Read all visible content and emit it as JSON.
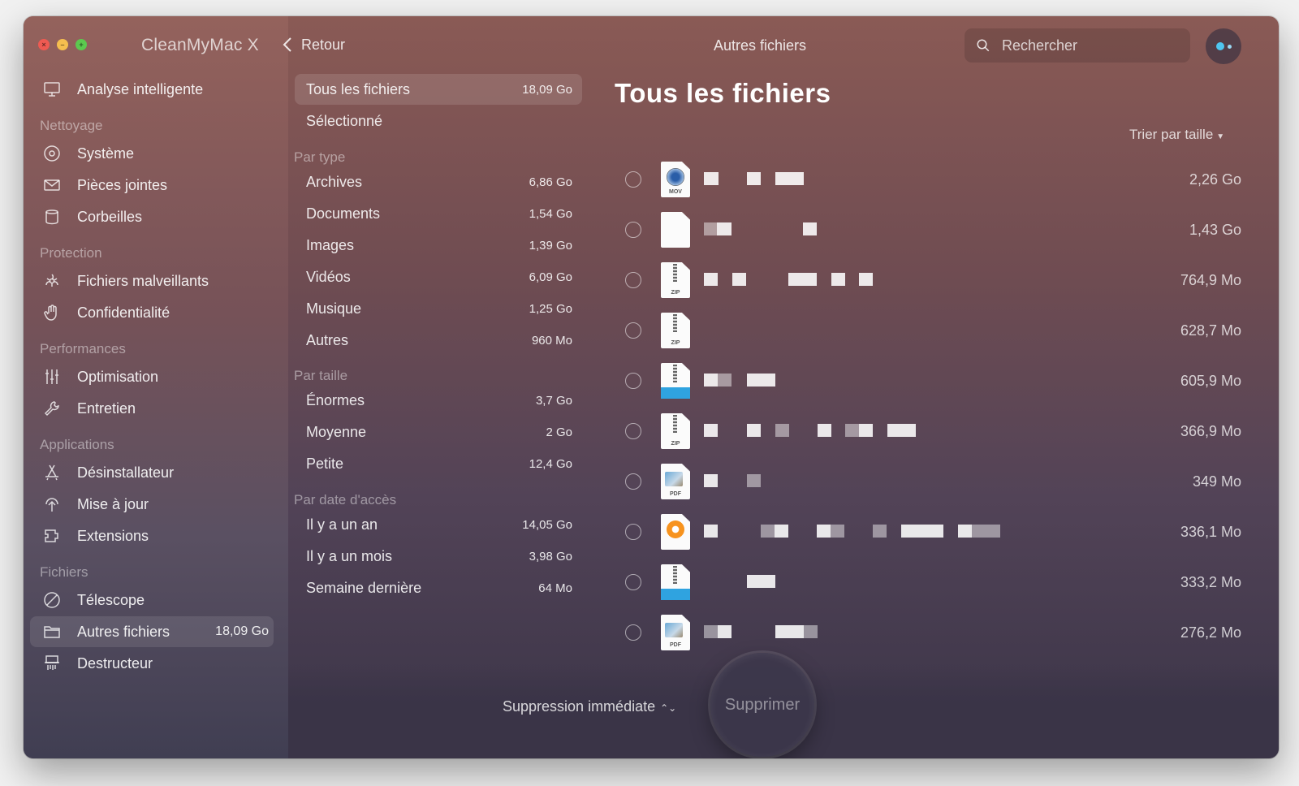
{
  "window": {
    "app_name": "CleanMyMac X",
    "back_label": "Retour",
    "toolbar_title": "Autres fichiers",
    "search_placeholder": "Rechercher"
  },
  "sidebar": {
    "top_item": {
      "label": "Analyse intelligente",
      "icon": "monitor-icon"
    },
    "sections": [
      {
        "title": "Nettoyage",
        "items": [
          {
            "label": "Système",
            "icon": "disk-icon"
          },
          {
            "label": "Pièces jointes",
            "icon": "mail-icon"
          },
          {
            "label": "Corbeilles",
            "icon": "trash-icon"
          }
        ]
      },
      {
        "title": "Protection",
        "items": [
          {
            "label": "Fichiers malveillants",
            "icon": "biohazard-icon"
          },
          {
            "label": "Confidentialité",
            "icon": "hand-icon"
          }
        ]
      },
      {
        "title": "Performances",
        "items": [
          {
            "label": "Optimisation",
            "icon": "sliders-icon"
          },
          {
            "label": "Entretien",
            "icon": "wrench-icon"
          }
        ]
      },
      {
        "title": "Applications",
        "items": [
          {
            "label": "Désinstallateur",
            "icon": "app-store-icon"
          },
          {
            "label": "Mise à jour",
            "icon": "update-icon"
          },
          {
            "label": "Extensions",
            "icon": "extensions-icon"
          }
        ]
      },
      {
        "title": "Fichiers",
        "items": [
          {
            "label": "Télescope",
            "icon": "telescope-icon"
          },
          {
            "label": "Autres fichiers",
            "icon": "folder-icon",
            "count": "18,09 Go",
            "active": true
          },
          {
            "label": "Destructeur",
            "icon": "shredder-icon"
          }
        ]
      }
    ]
  },
  "categories": {
    "all": {
      "label": "Tous les fichiers",
      "size": "18,09 Go"
    },
    "selected": {
      "label": "Sélectionné"
    },
    "by_type": {
      "title": "Par type",
      "items": [
        {
          "label": "Archives",
          "size": "6,86 Go"
        },
        {
          "label": "Documents",
          "size": "1,54 Go"
        },
        {
          "label": "Images",
          "size": "1,39 Go"
        },
        {
          "label": "Vidéos",
          "size": "6,09 Go"
        },
        {
          "label": "Musique",
          "size": "1,25 Go"
        },
        {
          "label": "Autres",
          "size": "960 Mo"
        }
      ]
    },
    "by_size": {
      "title": "Par taille",
      "items": [
        {
          "label": "Énormes",
          "size": "3,7 Go"
        },
        {
          "label": "Moyenne",
          "size": "2 Go"
        },
        {
          "label": "Petite",
          "size": "12,4 Go"
        }
      ]
    },
    "by_date": {
      "title": "Par date d'accès",
      "items": [
        {
          "label": "Il y a un an",
          "size": "14,05 Go"
        },
        {
          "label": "Il y a un mois",
          "size": "3,98 Go"
        },
        {
          "label": "Semaine dernière",
          "size": "64 Mo"
        }
      ]
    }
  },
  "main": {
    "title": "Tous les fichiers",
    "sort_label": "Trier par taille",
    "files": [
      {
        "type": "mov",
        "size": "2,26 Go"
      },
      {
        "type": "doc",
        "size": "1,43 Go"
      },
      {
        "type": "zip",
        "size": "764,9 Mo"
      },
      {
        "type": "zip",
        "size": "628,7 Mo"
      },
      {
        "type": "archive",
        "size": "605,9 Mo"
      },
      {
        "type": "zip",
        "size": "366,9 Mo"
      },
      {
        "type": "pdf",
        "size": "349 Mo"
      },
      {
        "type": "book",
        "size": "336,1 Mo"
      },
      {
        "type": "archive",
        "size": "333,2 Mo"
      },
      {
        "type": "pdf",
        "size": "276,2 Mo"
      }
    ],
    "file_type_labels": {
      "mov": "MOV",
      "zip": "ZIP",
      "pdf": "PDF"
    }
  },
  "footer": {
    "mode_label": "Suppression immédiate",
    "delete_label": "Supprimer"
  }
}
